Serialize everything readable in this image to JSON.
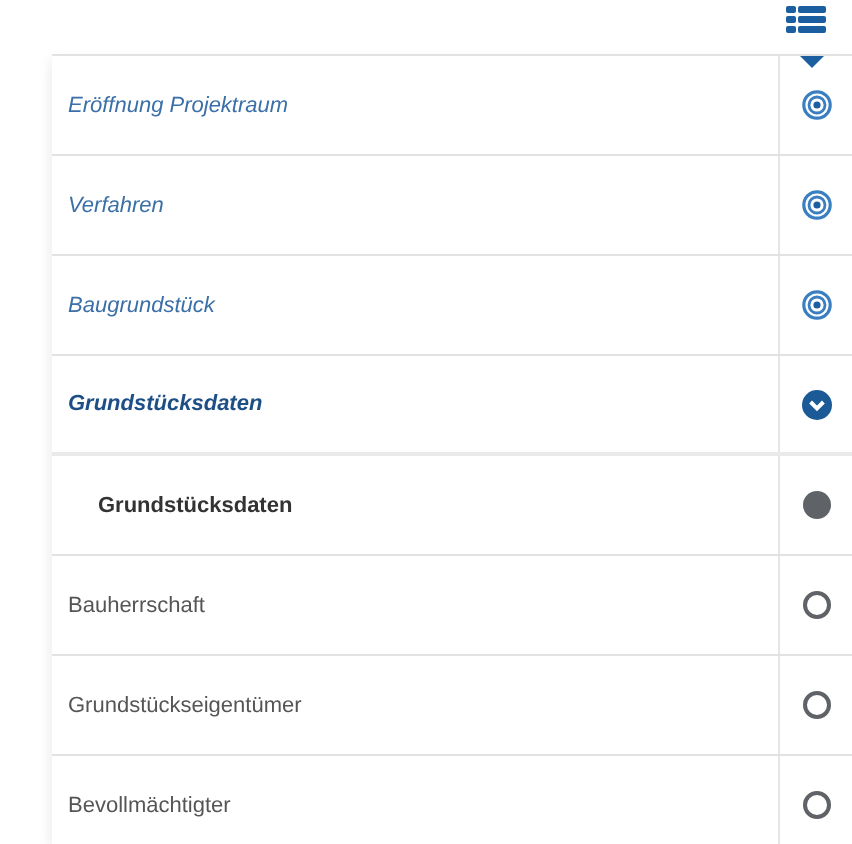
{
  "steps": [
    {
      "label": "Eröffnung Projektraum",
      "kind": "done"
    },
    {
      "label": "Verfahren",
      "kind": "done"
    },
    {
      "label": "Baugrundstück",
      "kind": "done"
    },
    {
      "label": "Grundstücksdaten",
      "kind": "group"
    },
    {
      "label": "Grundstücksdaten",
      "kind": "current"
    },
    {
      "label": "Bauherrschaft",
      "kind": "todo"
    },
    {
      "label": "Grundstückseigentümer",
      "kind": "todo"
    },
    {
      "label": "Bevollmächtigter",
      "kind": "todo"
    }
  ]
}
